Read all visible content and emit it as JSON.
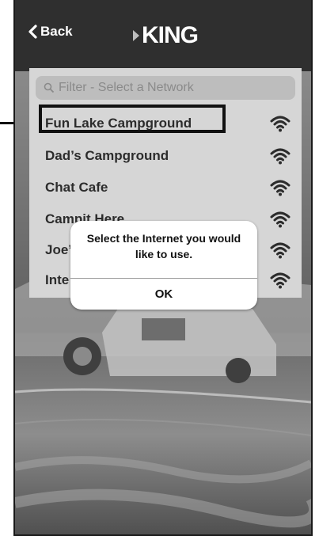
{
  "header": {
    "back_label": "Back",
    "logo_text": "KING"
  },
  "search": {
    "placeholder": "Filter - Select a Network"
  },
  "networks": [
    {
      "name": "Fun Lake Campground",
      "icon": "wifi-icon",
      "highlighted": true
    },
    {
      "name": "Dad’s Campground",
      "icon": "wifi-icon"
    },
    {
      "name": "Chat Cafe",
      "icon": "wifi-icon"
    },
    {
      "name": "Campit Here",
      "icon": "wifi-icon"
    },
    {
      "name": "Joe’s",
      "icon": "wifi-icon"
    },
    {
      "name": "Inte",
      "icon": "wifi-icon"
    }
  ],
  "dialog": {
    "message": "Select the Internet you would like to use.",
    "ok_label": "OK"
  },
  "colors": {
    "header_bg": "#2f2f2f",
    "panel_bg": "#d6d6d6",
    "text_dark": "#2c2c2c",
    "dialog_bg": "#ffffff"
  }
}
